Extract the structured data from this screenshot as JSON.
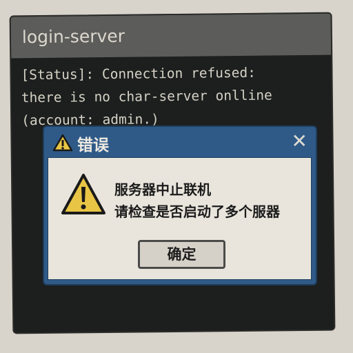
{
  "terminal": {
    "title": "login-server",
    "lines": [
      "[Status]: Connection refused:",
      "there is no char-server onlline",
      "(account: admin.)"
    ]
  },
  "dialog": {
    "title": "错误",
    "message_line1": "服务器中止联机",
    "message_line2": "请检查是否启动了多个服器",
    "ok_label": "确定",
    "close_glyph": "✕",
    "icons": {
      "title": "warning-icon",
      "body": "warning-icon",
      "close": "close-icon"
    }
  },
  "colors": {
    "background": "#d8d3cb",
    "terminal": "#1c1f1e",
    "dialog_title": "#2f5a88",
    "warning": "#e8c544"
  }
}
